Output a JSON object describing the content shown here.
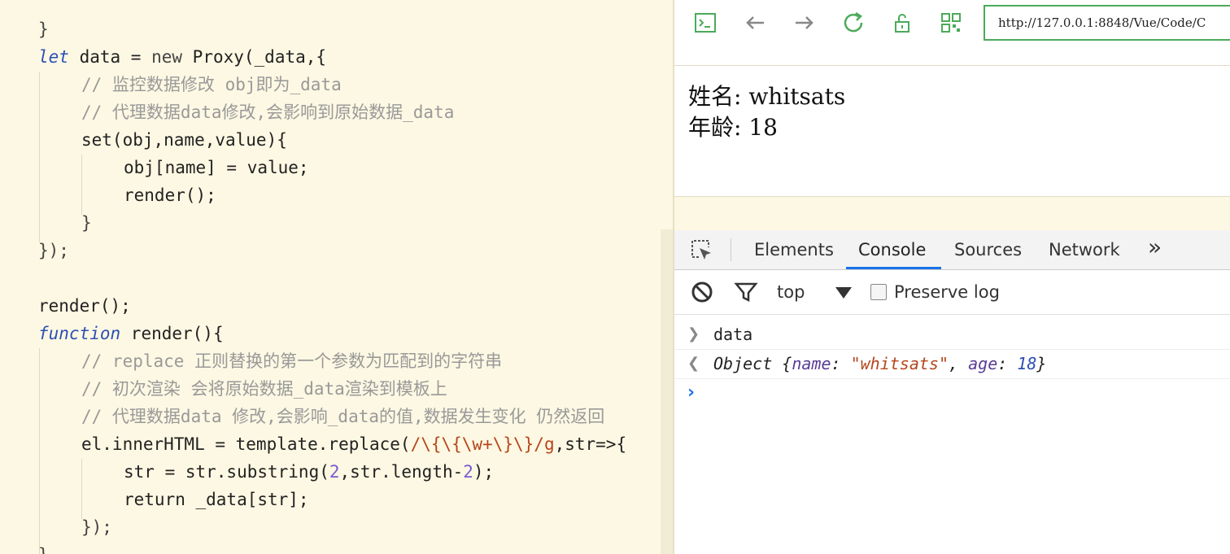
{
  "editor": {
    "lines": [
      [
        {
          "t": "}",
          "c": "#444",
          "i": false
        }
      ],
      [
        {
          "t": "let",
          "c": "#2c4fb5",
          "i": true
        },
        {
          "t": " data = ",
          "c": "#222",
          "i": false
        },
        {
          "t": "new",
          "c": "#444",
          "i": false
        },
        {
          "t": " Proxy(_data,{",
          "c": "#222",
          "i": false
        }
      ],
      [
        {
          "t": "// 监控数据修改 obj即为_data",
          "c": "#999",
          "i": false
        }
      ],
      [
        {
          "t": "// 代理数据data修改,会影响到原始数据_data",
          "c": "#999",
          "i": false
        }
      ],
      [
        {
          "t": "set(obj,name,value){",
          "c": "#222",
          "i": false
        }
      ],
      [
        {
          "t": "obj[name] = value;",
          "c": "#222",
          "i": false
        }
      ],
      [
        {
          "t": "render();",
          "c": "#222",
          "i": false
        }
      ],
      [
        {
          "t": "}",
          "c": "#444",
          "i": false
        }
      ],
      [
        {
          "t": "});",
          "c": "#444",
          "i": false
        }
      ],
      [],
      [
        {
          "t": "render();",
          "c": "#222",
          "i": false
        }
      ],
      [
        {
          "t": "function",
          "c": "#2c4fb5",
          "i": true
        },
        {
          "t": " render(){",
          "c": "#222",
          "i": false
        }
      ],
      [
        {
          "t": "// replace 正则替换的第一个参数为匹配到的字符串",
          "c": "#999",
          "i": false
        }
      ],
      [
        {
          "t": "// 初次渲染 会将原始数据_data渲染到模板上",
          "c": "#999",
          "i": false
        }
      ],
      [
        {
          "t": "// 代理数据data 修改,会影响_data的值,数据发生变化 仍然返回",
          "c": "#999",
          "i": false
        }
      ],
      [
        {
          "t": "el.innerHTML = template.replace(",
          "c": "#222",
          "i": false
        },
        {
          "t": "/\\{\\{\\w+\\}\\}/g",
          "c": "#b5461c",
          "i": false
        },
        {
          "t": ",str=>{",
          "c": "#222",
          "i": false
        }
      ],
      [
        {
          "t": "str = str.substring(",
          "c": "#222",
          "i": false
        },
        {
          "t": "2",
          "c": "#7a5bd1",
          "i": false
        },
        {
          "t": ",str.length-",
          "c": "#222",
          "i": false
        },
        {
          "t": "2",
          "c": "#7a5bd1",
          "i": false
        },
        {
          "t": ");",
          "c": "#222",
          "i": false
        }
      ],
      [
        {
          "t": "return _data[str];",
          "c": "#222",
          "i": false
        }
      ],
      [
        {
          "t": "});",
          "c": "#444",
          "i": false
        }
      ],
      [
        {
          "t": "}",
          "c": "#444",
          "i": false
        }
      ]
    ]
  },
  "browser": {
    "url": "http://127.0.0.1:8848/Vue/Code/C",
    "page": {
      "name_label": "姓名: whitsats",
      "age_label": "年龄: 18"
    }
  },
  "devtools": {
    "tabs": [
      "Elements",
      "Console",
      "Sources",
      "Network"
    ],
    "active_tab": "Console",
    "more_tabs": "»",
    "context": "top",
    "preserve_log": "Preserve log",
    "console": {
      "input_cmd": "data",
      "result": [
        {
          "t": "Object {",
          "c": "#222",
          "i": true
        },
        {
          "t": "name",
          "c": "#5a3c96",
          "i": true
        },
        {
          "t": ": ",
          "c": "#222",
          "i": true
        },
        {
          "t": "\"whitsats\"",
          "c": "#b5461c",
          "i": true
        },
        {
          "t": ", ",
          "c": "#222",
          "i": true
        },
        {
          "t": "age",
          "c": "#5a3c96",
          "i": true
        },
        {
          "t": ": ",
          "c": "#222",
          "i": true
        },
        {
          "t": "18",
          "c": "#2c4fb5",
          "i": true
        },
        {
          "t": "}",
          "c": "#222",
          "i": true
        }
      ],
      "prompt": "›"
    }
  },
  "colors": {
    "editor_bg": "#fdf8e3",
    "accent_green": "#4caa5a",
    "tab_active": "#1a73e8"
  }
}
